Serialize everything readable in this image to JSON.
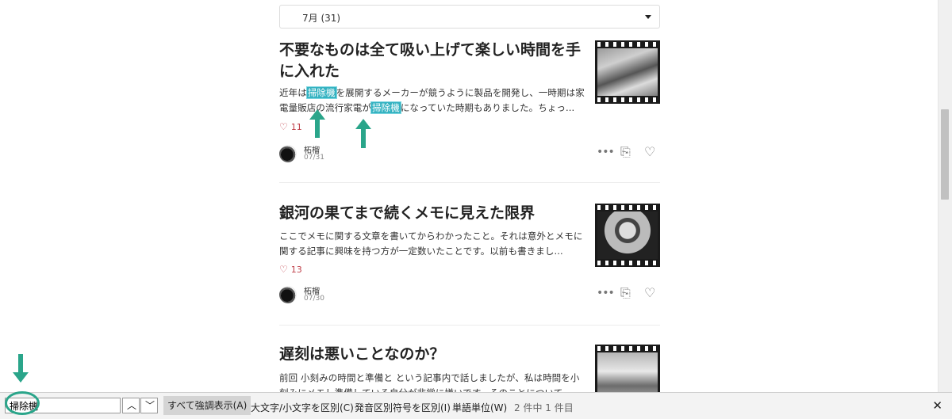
{
  "month_select": {
    "label": "7月 (31)"
  },
  "articles": [
    {
      "title": "不要なものは全て吸い上げて楽しい時間を手に入れた",
      "excerpt_parts": [
        "近年は",
        "掃除機",
        "を展開するメーカーが競うように製品を開発し、一時期は家電量販店の流行家電が",
        "掃除機",
        "になっていた時期もありました。ちょっ..."
      ],
      "likes": "11",
      "author": "柘榴",
      "date": "07/31"
    },
    {
      "title": "銀河の果てまで続くメモに見えた限界",
      "excerpt": "ここでメモに関する文章を書いてからわかったこと。それは意外とメモに関する記事に興味を持つ方が一定数いたことです。以前も書きまし...",
      "likes": "13",
      "author": "柘榴",
      "date": "07/30"
    },
    {
      "title": "遅刻は悪いことなのか？",
      "excerpt": "前回 小刻みの時間と準備と という記事内で話しましたが、私は時間を小刻みにメモし準備している自分が非常に嫌いです。そのことについて..."
    }
  ],
  "icons": {
    "more": "more-icon",
    "bookmark": "book-add-icon",
    "like": "heart-icon"
  },
  "findbar": {
    "query": "掃除機",
    "highlight_all": "すべて強調表示(A)",
    "match_case": "大文字/小文字を区別(C)",
    "match_diacritics": "発音区別符号を区別(I)",
    "whole_words": "単語単位(W)",
    "count": "2 件中 1 件目"
  },
  "colors": {
    "highlight": "#33b2c1",
    "annotation": "#2aa58a",
    "likes": "#c0404a"
  }
}
